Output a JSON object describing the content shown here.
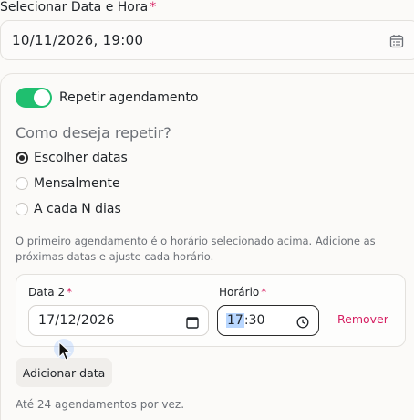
{
  "schedule": {
    "label": "Selecionar Data e Hora",
    "required_mark": "*",
    "datetime_value": "10/11/2026, 19:00"
  },
  "repeat": {
    "toggle_label": "Repetir agendamento",
    "toggle_on": true,
    "question": "Como deseja repetir?",
    "options": [
      {
        "label": "Escolher datas",
        "checked": true
      },
      {
        "label": "Mensalmente",
        "checked": false
      },
      {
        "label": "A cada N dias",
        "checked": false
      }
    ],
    "info": "O primeiro agendamento é o horário selecionado acima. Adicione as próximas datas e ajuste cada horário.",
    "entry": {
      "date_label": "Data 2",
      "date_value": "17/12/2026",
      "time_label": "Horário",
      "time_hour": "17",
      "time_rest": ":30",
      "remove_label": "Remover"
    },
    "add_label": "Adicionar data",
    "footer": "Até 24 agendamentos por vez."
  },
  "colors": {
    "accent_green": "#1fbf6f",
    "accent_pink": "#d61f62",
    "selection_blue": "#b9d7ff"
  }
}
